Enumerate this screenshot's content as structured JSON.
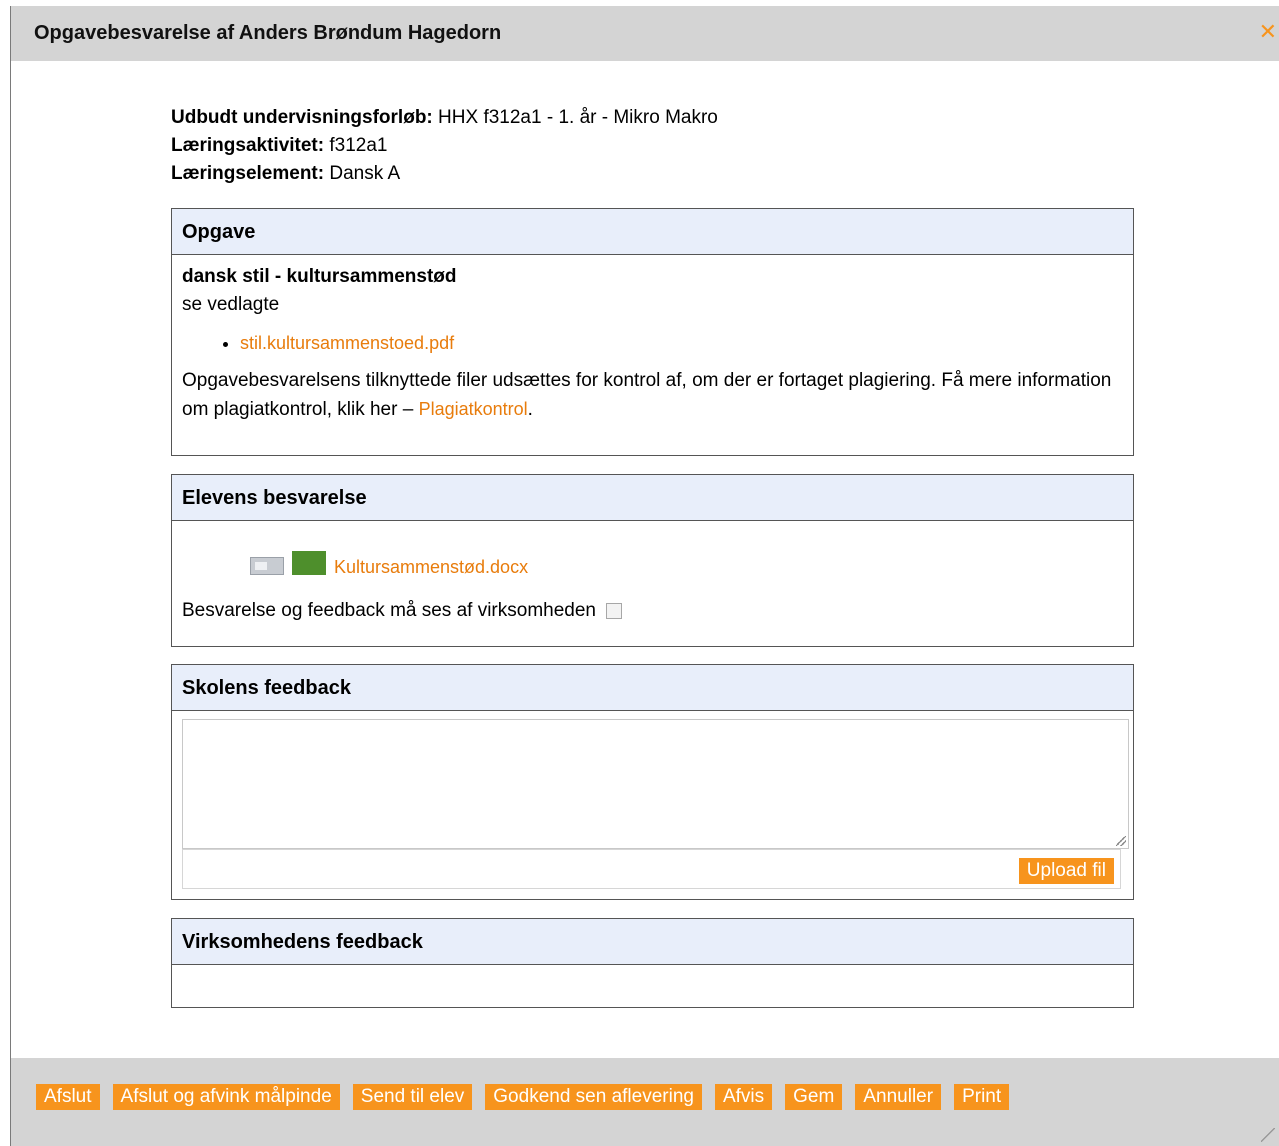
{
  "dialog": {
    "title": "Opgavebesvarelse af Anders Brøndum Hagedorn",
    "close_glyph": "✕"
  },
  "meta": {
    "course_label": "Udbudt undervisningsforløb:",
    "course_value": "HHX f312a1 - 1. år - Mikro Makro",
    "activity_label": "Læringsaktivitet:",
    "activity_value": "f312a1",
    "element_label": "Læringselement:",
    "element_value": "Dansk A"
  },
  "task": {
    "header": "Opgave",
    "title": "dansk stil - kultursammenstød",
    "description": "se vedlagte",
    "attachment": "stil.kultursammenstoed.pdf",
    "plagiarism_text": "Opgavebesvarelsens tilknyttede filer udsættes for kontrol af, om der er fortaget plagiering. Få mere information om plagiatkontrol, klik her – ",
    "plagiarism_link": "Plagiatkontrol",
    "plagiarism_end": "."
  },
  "answer": {
    "header": "Elevens besvarelse",
    "file_name": "Kultursammenstød.docx",
    "visibility_label": "Besvarelse og feedback må ses af virksomheden",
    "visibility_checked": false
  },
  "school_feedback": {
    "header": "Skolens feedback",
    "text": "",
    "upload_label": "Upload fil"
  },
  "company_feedback": {
    "header": "Virksomhedens feedback"
  },
  "footer": {
    "buttons": [
      "Afslut",
      "Afslut og afvink målpinde",
      "Send til elev",
      "Godkend sen aflevering",
      "Afvis",
      "Gem",
      "Annuller",
      "Print"
    ]
  },
  "colors": {
    "accent": "#f7941d",
    "link": "#e87c0c",
    "section_header_bg": "#e8eefa",
    "titlebar_bg": "#d4d4d4"
  }
}
